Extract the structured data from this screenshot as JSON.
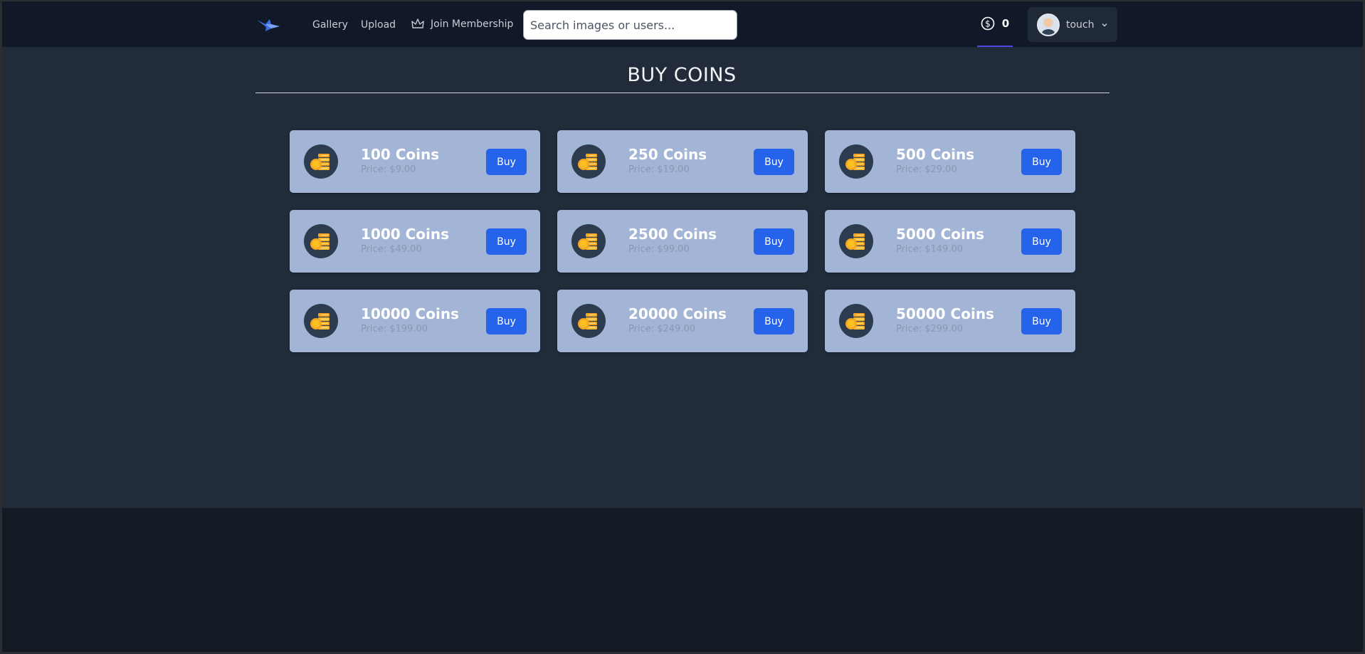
{
  "nav": {
    "links": [
      "Gallery",
      "Upload",
      "Join Membership"
    ],
    "search_placeholder": "Search images or users...",
    "coin_balance": "0",
    "username": "touch"
  },
  "main": {
    "title": "BUY COINS",
    "packages": [
      {
        "name": "100 Coins",
        "price": "Price: $9.00",
        "button": "Buy"
      },
      {
        "name": "250 Coins",
        "price": "Price: $19.00",
        "button": "Buy"
      },
      {
        "name": "500 Coins",
        "price": "Price: $29.00",
        "button": "Buy"
      },
      {
        "name": "1000 Coins",
        "price": "Price: $49.00",
        "button": "Buy"
      },
      {
        "name": "2500 Coins",
        "price": "Price: $99.00",
        "button": "Buy"
      },
      {
        "name": "5000 Coins",
        "price": "Price: $149.00",
        "button": "Buy"
      },
      {
        "name": "10000 Coins",
        "price": "Price: $199.00",
        "button": "Buy"
      },
      {
        "name": "20000 Coins",
        "price": "Price: $249.00",
        "button": "Buy"
      },
      {
        "name": "50000 Coins",
        "price": "Price: $299.00",
        "button": "Buy"
      }
    ]
  },
  "icons": {
    "logo": "bird-logo-icon",
    "membership": "crown-icon",
    "balance": "dollar-coin-icon",
    "user_menu": "chevron-down-icon",
    "package": "coin-stack-icon"
  },
  "colors": {
    "navbar_bg": "#111827",
    "main_bg": "#222b39",
    "card_bg": "#a3b5d6",
    "button_bg": "#2563eb",
    "active_underline": "#4f46e5"
  }
}
